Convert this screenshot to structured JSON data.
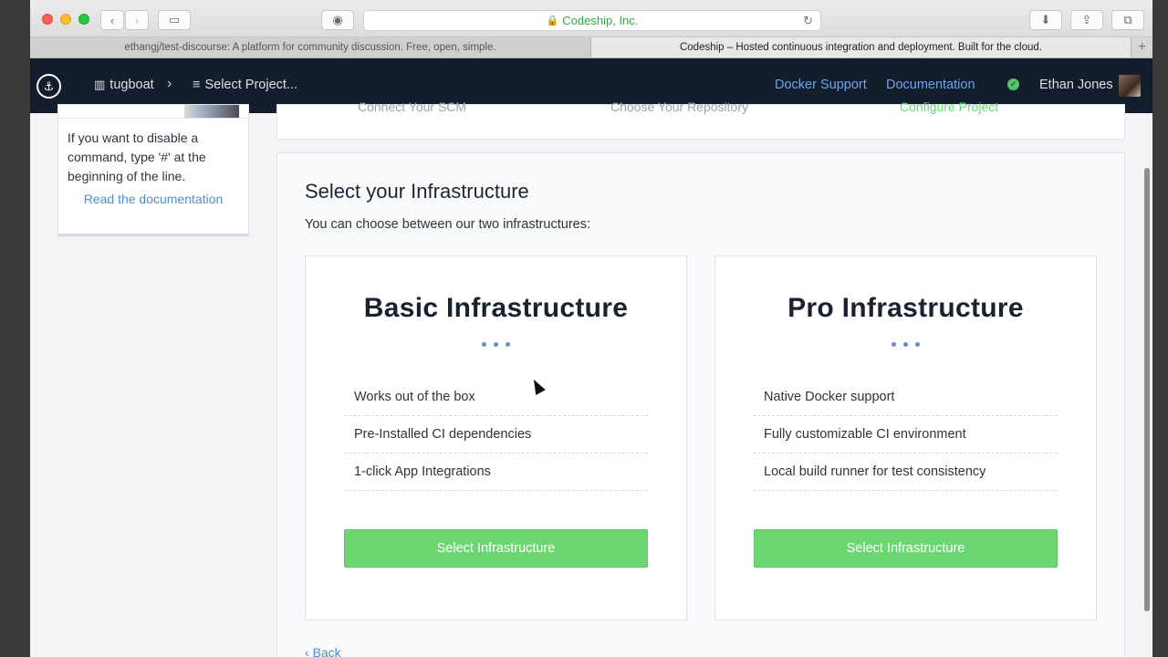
{
  "browser": {
    "url": "Codeship, Inc.",
    "tabs": [
      {
        "label": "ethangj/test-discourse: A platform for community discussion. Free, open, simple.",
        "active": false
      },
      {
        "label": "Codeship – Hosted continuous integration and deployment. Built for the cloud.",
        "active": true
      }
    ],
    "new_tab": "+"
  },
  "nav": {
    "org": "tugboat",
    "separator": "›",
    "project_select": "Select Project...",
    "links": {
      "docker_support": "Docker Support",
      "documentation": "Documentation"
    },
    "status_check": "✓",
    "user": "Ethan Jones"
  },
  "sidebar": {
    "help_text": "If you want to disable a command, type '#' at the beginning of the line.",
    "read_docs": "Read the documentation"
  },
  "steps": [
    {
      "label": "Connect Your SCM",
      "state": "done"
    },
    {
      "label": "Choose Your Repository",
      "state": "done"
    },
    {
      "label": "Configure Project",
      "state": "active"
    }
  ],
  "main": {
    "title": "Select your Infrastructure",
    "subtitle": "You can choose between our two infrastructures:",
    "back": "Back",
    "infrastructures": [
      {
        "title": "Basic Infrastructure",
        "features": [
          "Works out of the box",
          "Pre-Installed CI dependencies",
          "1-click App Integrations"
        ],
        "button": "Select Infrastructure"
      },
      {
        "title": "Pro Infrastructure",
        "features": [
          "Native Docker support",
          "Fully customizable CI environment",
          "Local build runner for test consistency"
        ],
        "button": "Select Infrastructure"
      }
    ]
  },
  "colors": {
    "nav_bg": "#131d2c",
    "link": "#6fa5e8",
    "primary_button": "#6bd672",
    "active_step": "#52c46a"
  }
}
